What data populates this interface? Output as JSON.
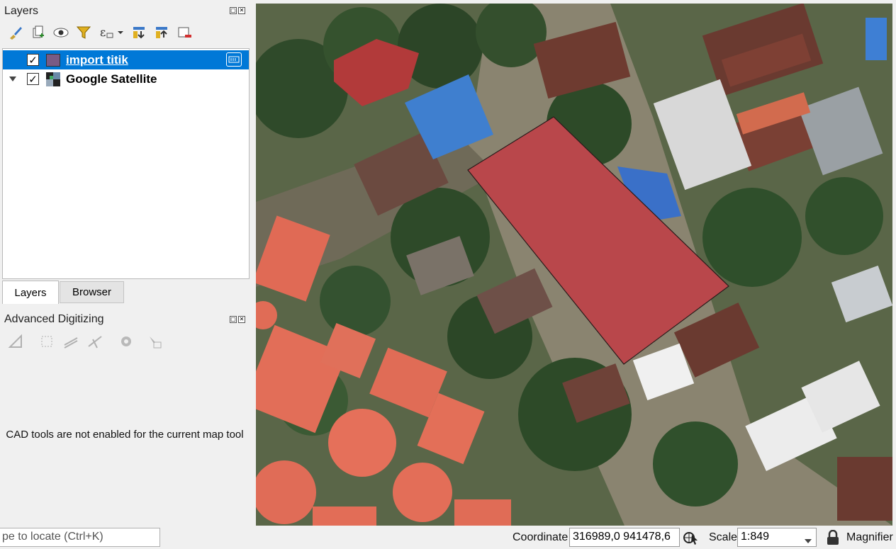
{
  "layers_panel": {
    "title": "Layers",
    "toolbar_icons": [
      "paint-brush-icon",
      "add-group-icon",
      "eye-icon",
      "filter-icon",
      "expression-icon",
      "expand-all-icon",
      "collapse-all-icon",
      "remove-layer-icon"
    ],
    "layers": [
      {
        "name": "import titik",
        "checked": true,
        "selected": true,
        "type": "polygon",
        "swatch_color": "#7a5b85"
      },
      {
        "name": "Google Satellite",
        "checked": true,
        "selected": false,
        "type": "raster"
      }
    ]
  },
  "tabs": {
    "layers": "Layers",
    "browser": "Browser"
  },
  "digitizing_panel": {
    "title": "Advanced Digitizing",
    "message": "CAD tools are not enabled for the current map tool"
  },
  "map": {
    "polygon_fill": "#b9474b"
  },
  "statusbar": {
    "locator_placeholder": "pe to locate (Ctrl+K)",
    "coordinate_label": "Coordinate",
    "coordinate_value": "316989,0 941478,6",
    "scale_label": "Scale",
    "scale_value": "1:849",
    "magnifier_label": "Magnifier"
  },
  "checkmark": "✓",
  "float_glyphs": {
    "float": "▢",
    "close": "✕"
  }
}
